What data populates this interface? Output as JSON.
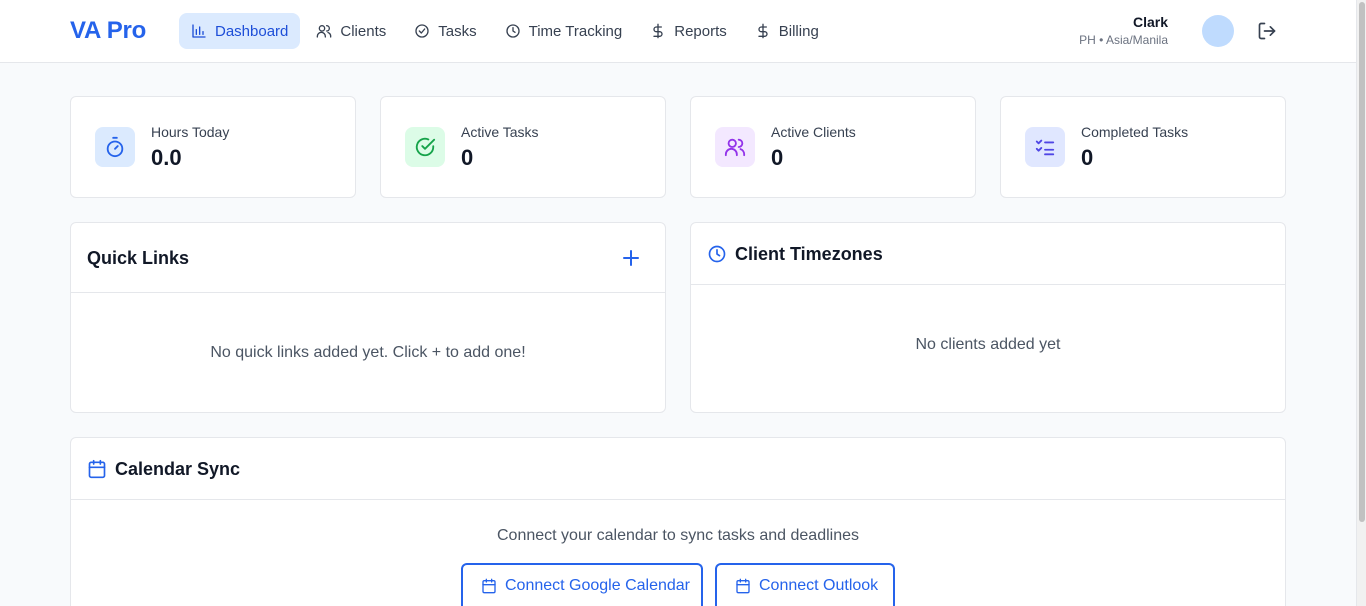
{
  "app": {
    "brand": "VA Pro"
  },
  "nav": [
    {
      "label": "Dashboard",
      "icon": "bar-chart-icon",
      "active": true
    },
    {
      "label": "Clients",
      "icon": "users-icon"
    },
    {
      "label": "Tasks",
      "icon": "check-circle-icon"
    },
    {
      "label": "Time Tracking",
      "icon": "clock-icon"
    },
    {
      "label": "Reports",
      "icon": "dollar-icon"
    },
    {
      "label": "Billing",
      "icon": "dollar-icon"
    }
  ],
  "user": {
    "name": "Clark",
    "timezone": "PH • Asia/Manila"
  },
  "stats": [
    {
      "label": "Hours Today",
      "value": "0.0",
      "icon": "timer-icon",
      "color": "#2563eb",
      "bg": "#dbeafe"
    },
    {
      "label": "Active Tasks",
      "value": "0",
      "icon": "check-circle-icon",
      "color": "#16a34a",
      "bg": "#dcfce7"
    },
    {
      "label": "Active Clients",
      "value": "0",
      "icon": "users-icon",
      "color": "#9333ea",
      "bg": "#f3e8ff"
    },
    {
      "label": "Completed Tasks",
      "value": "0",
      "icon": "list-checks-icon",
      "color": "#4f46e5",
      "bg": "#e0e7ff"
    }
  ],
  "quick_links": {
    "title": "Quick Links",
    "empty": "No quick links added yet. Click + to add one!"
  },
  "timezones": {
    "title": "Client Timezones",
    "empty": "No clients added yet"
  },
  "calendar": {
    "title": "Calendar Sync",
    "description": "Connect your calendar to sync tasks and deadlines",
    "google_label": "Connect Google Calendar",
    "outlook_label": "Connect Outlook"
  },
  "colors": {
    "accent": "#2563eb",
    "active_nav_bg": "#dbeafe"
  }
}
